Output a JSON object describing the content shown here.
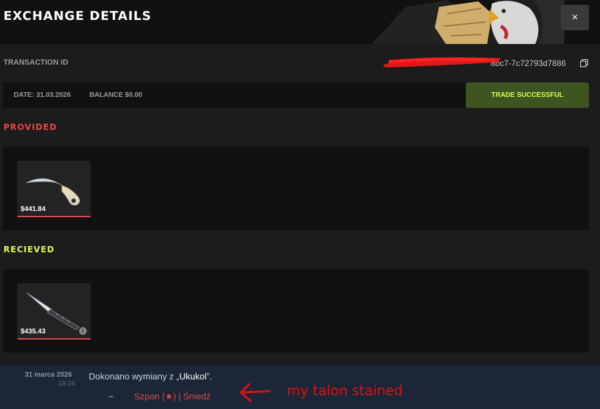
{
  "modal": {
    "title": "EXCHANGE DETAILS",
    "close_symbol": "×",
    "transaction": {
      "label": "TRANSACTION ID",
      "value_visible": "8bc7-7c72793d7886"
    },
    "info": {
      "date": "DATE: 31.03.2026",
      "balance": "BALANCE $0.00",
      "status": "TRADE SUCCESSFUL"
    },
    "provided": {
      "title": "PROVIDED",
      "items": [
        {
          "price": "$441.84",
          "icon": "karambit-icon"
        }
      ]
    },
    "received": {
      "title": "RECIEVED",
      "items": [
        {
          "price": "$435.43",
          "icon": "skeleton-knife-icon"
        }
      ]
    }
  },
  "steam_notice": {
    "date": "31 marca 2026",
    "time": "19:24",
    "message_prefix": "Dokonano wymiany z „",
    "username": "Ukukol",
    "message_suffix": "”.",
    "dash": "–",
    "item_name": "Szpon (★) | Śniedź"
  },
  "annotation": {
    "text": "my talon stained"
  },
  "colors": {
    "accent_red": "#e24848",
    "accent_green": "#d8ff4a",
    "status_bg": "#3e5521",
    "steam_bg": "#1b2738",
    "annotation_red": "#e01010"
  }
}
